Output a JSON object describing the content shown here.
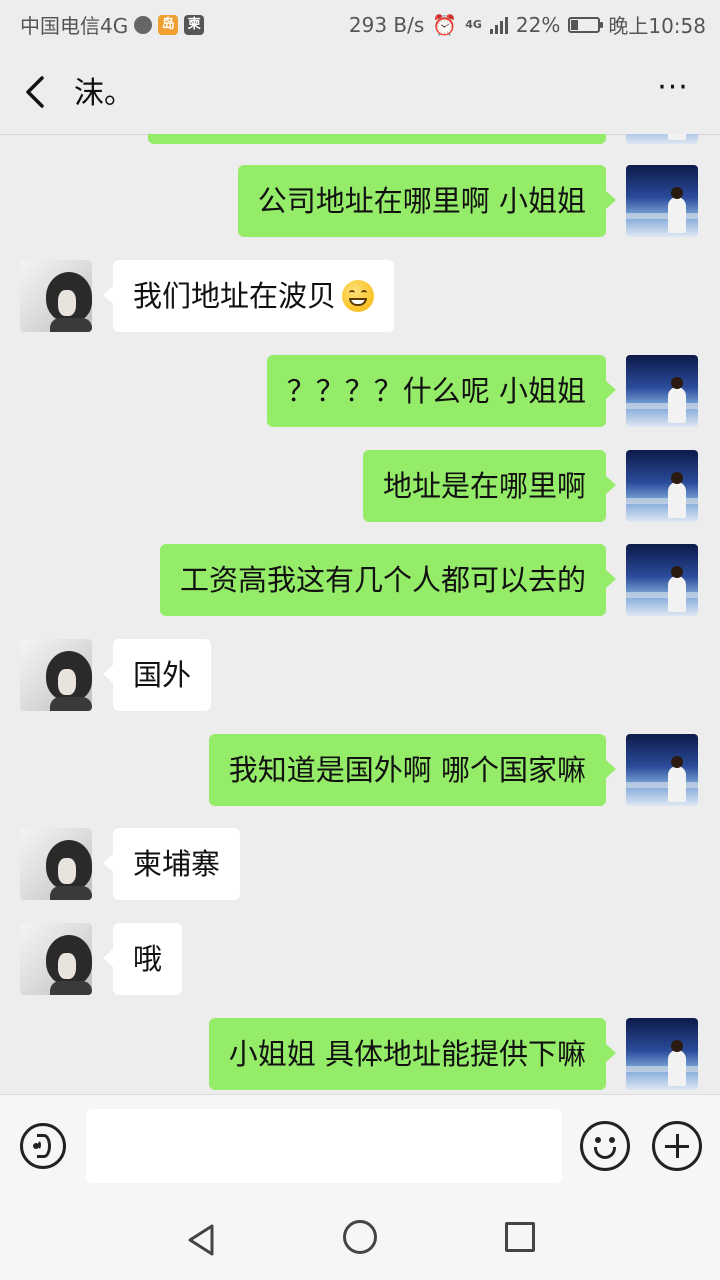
{
  "status_bar": {
    "carrier": "中国电信4G",
    "app_badge_1": "岛",
    "app_badge_2": "柬",
    "speed": "293 B/s",
    "network": "4G",
    "battery": "22%",
    "battery_level": 0.22,
    "time": "晚上10:58"
  },
  "header": {
    "title": "沫。",
    "more": "···"
  },
  "colors": {
    "outgoing_bubble": "#95ec69",
    "incoming_bubble": "#ffffff",
    "chat_background": "#ededed"
  },
  "messages": [
    {
      "from": "me",
      "text": ""
    },
    {
      "from": "me",
      "text": "公司地址在哪里啊 小姐姐"
    },
    {
      "from": "her",
      "text": "我们地址在波贝",
      "emoji": "grinning-emoji"
    },
    {
      "from": "me",
      "text": "？？？？什么呢 小姐姐"
    },
    {
      "from": "me",
      "text": "地址是在哪里啊"
    },
    {
      "from": "me",
      "text": "工资高我这有几个人都可以去的"
    },
    {
      "from": "her",
      "text": "国外"
    },
    {
      "from": "me",
      "text": "我知道是国外啊 哪个国家嘛"
    },
    {
      "from": "her",
      "text": "柬埔寨"
    },
    {
      "from": "her",
      "text": "哦"
    },
    {
      "from": "me",
      "text": "小姐姐 具体地址能提供下嘛"
    }
  ],
  "input": {
    "placeholder": ""
  }
}
